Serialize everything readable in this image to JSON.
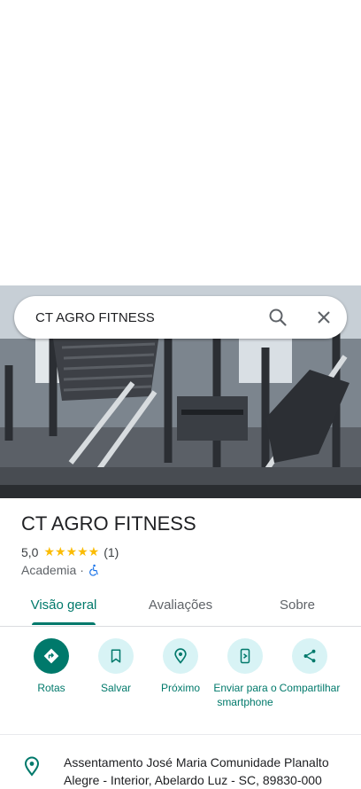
{
  "search": {
    "query": "CT AGRO FITNESS"
  },
  "place": {
    "name": "CT AGRO FITNESS",
    "rating": "5,0",
    "stars": "★★★★★",
    "review_count": "(1)",
    "category": "Academia",
    "separator": "·",
    "accessible_icon": "wheelchair-icon"
  },
  "tabs": [
    {
      "label": "Visão geral",
      "active": true
    },
    {
      "label": "Avaliações",
      "active": false
    },
    {
      "label": "Sobre",
      "active": false
    }
  ],
  "actions": [
    {
      "label": "Rotas",
      "icon": "directions-icon"
    },
    {
      "label": "Salvar",
      "icon": "bookmark-icon"
    },
    {
      "label": "Próximo",
      "icon": "nearby-icon"
    },
    {
      "label": "Enviar para o smartphone",
      "icon": "send-to-phone-icon"
    },
    {
      "label": "Compartilhar",
      "icon": "share-icon"
    }
  ],
  "address": "Assentamento José Maria Comunidade Planalto Alegre - Interior, Abelardo Luz - SC, 89830-000",
  "colors": {
    "accent": "#00796b",
    "action_bg": "#d8f3f5",
    "star": "#fbbc04"
  }
}
